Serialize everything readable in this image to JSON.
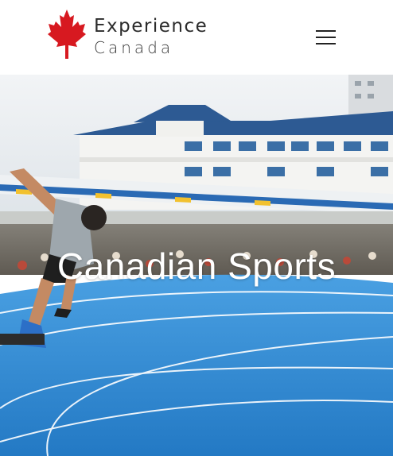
{
  "header": {
    "brand_line1": "Experience",
    "brand_line2": "Canada",
    "logo_icon": "maple-leaf-icon",
    "menu_icon": "hamburger-menu-icon"
  },
  "hero": {
    "title": "Canadian Sports"
  },
  "colors": {
    "maple_red": "#d71920",
    "track_blue": "#2f8ad4",
    "sky": "#e9eef2",
    "roof_blue": "#3b6fa6"
  }
}
